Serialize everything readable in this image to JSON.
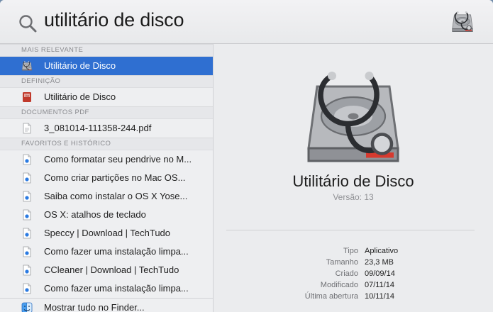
{
  "search": {
    "query": "utilitário de disco"
  },
  "results": {
    "sections": [
      {
        "header": "MAIS RELEVANTE",
        "items": [
          {
            "label": "Utilitário de Disco",
            "icon": "disk-utility-app-icon",
            "selected": true
          }
        ]
      },
      {
        "header": "DEFINIÇÃO",
        "items": [
          {
            "label": "Utilitário de Disco",
            "icon": "dictionary-icon"
          }
        ]
      },
      {
        "header": "DOCUMENTOS PDF",
        "items": [
          {
            "label": "3_081014-111358-244.pdf",
            "icon": "pdf-document-icon"
          }
        ]
      },
      {
        "header": "FAVORITOS E HISTÓRICO",
        "items": [
          {
            "label": "Como formatar seu pendrive no M...",
            "icon": "webloc-icon"
          },
          {
            "label": "Como criar partições no Mac OS...",
            "icon": "webloc-icon"
          },
          {
            "label": "Saiba como instalar o OS X Yose...",
            "icon": "webloc-icon"
          },
          {
            "label": "OS X: atalhos de teclado",
            "icon": "webloc-icon"
          },
          {
            "label": "Speccy | Download | TechTudo",
            "icon": "webloc-icon"
          },
          {
            "label": "Como fazer uma instalação limpa...",
            "icon": "webloc-icon"
          },
          {
            "label": "CCleaner | Download | TechTudo",
            "icon": "webloc-icon"
          },
          {
            "label": "Como fazer uma instalação limpa...",
            "icon": "webloc-icon"
          }
        ]
      }
    ],
    "footer": {
      "label": "Mostrar tudo no Finder...",
      "icon": "finder-icon"
    }
  },
  "preview": {
    "title": "Utilitário de Disco",
    "version": "Versão: 13",
    "meta": [
      {
        "key": "Tipo",
        "value": "Aplicativo"
      },
      {
        "key": "Tamanho",
        "value": "23,3 MB"
      },
      {
        "key": "Criado",
        "value": "09/09/14"
      },
      {
        "key": "Modificado",
        "value": "07/11/14"
      },
      {
        "key": "Última abertura",
        "value": "10/11/14"
      }
    ]
  },
  "colors": {
    "selection": "#2f6fd1",
    "panel": "#ecedef"
  }
}
